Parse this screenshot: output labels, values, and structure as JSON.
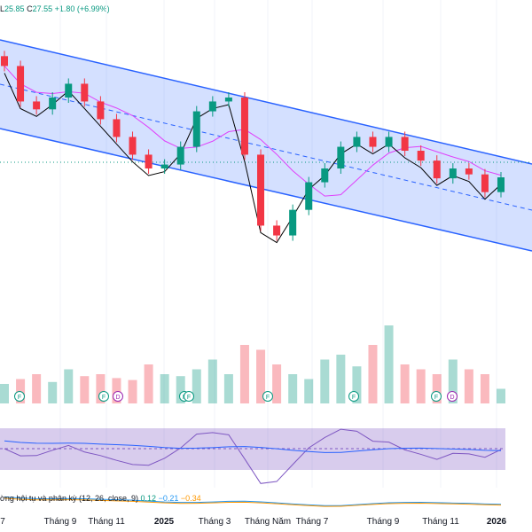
{
  "legend": {
    "low_label": "L",
    "low": "25.85",
    "close_label": "C",
    "close": "27.55",
    "change": "+1.80 (+6.99%)"
  },
  "macd_legend": {
    "title": "ờng hội tụ và phân kỳ (12, 26, close, 9)",
    "v1": "0.12",
    "v2": "−0.21",
    "v3": "−0.34"
  },
  "x_axis": [
    {
      "label": "7",
      "bold": false
    },
    {
      "label": "Tháng 9",
      "bold": false
    },
    {
      "label": "Tháng 11",
      "bold": false
    },
    {
      "label": "2025",
      "bold": true
    },
    {
      "label": "Tháng 3",
      "bold": false
    },
    {
      "label": "Tháng Năm",
      "bold": false
    },
    {
      "label": "Tháng 7",
      "bold": false
    },
    {
      "label": "Tháng 9",
      "bold": false
    },
    {
      "label": "Tháng 11",
      "bold": false
    },
    {
      "label": "2026",
      "bold": true
    }
  ],
  "events": [
    "F",
    "F",
    "D",
    "F",
    "F",
    "F",
    "F",
    "F",
    "D"
  ],
  "colors": {
    "up": "#089981",
    "down": "#f23645",
    "channel": "#2962ff",
    "rsi_band": "#7e57c2",
    "macd": "#2196f3",
    "signal": "#ff9800"
  },
  "chart_data": {
    "type": "candlestick",
    "title": "",
    "close": [
      33.2,
      31.4,
      31.0,
      31.6,
      32.3,
      31.4,
      30.5,
      29.6,
      28.7,
      28.0,
      28.2,
      29.1,
      30.9,
      31.4,
      31.6,
      28.7,
      25.1,
      24.6,
      25.9,
      27.3,
      28.0,
      29.1,
      29.6,
      29.1,
      29.6,
      28.9,
      28.4,
      27.5,
      28.0,
      27.7,
      26.8,
      27.55
    ],
    "volume": [
      20,
      25,
      30,
      22,
      35,
      28,
      30,
      26,
      24,
      40,
      30,
      28,
      35,
      45,
      30,
      60,
      55,
      40,
      30,
      25,
      45,
      50,
      38,
      60,
      80,
      40,
      35,
      30,
      45,
      35,
      30,
      15
    ],
    "rsi_range": [
      30,
      70
    ],
    "macd": {
      "macd": 0.12,
      "signal": -0.21,
      "histogram": -0.34
    }
  }
}
